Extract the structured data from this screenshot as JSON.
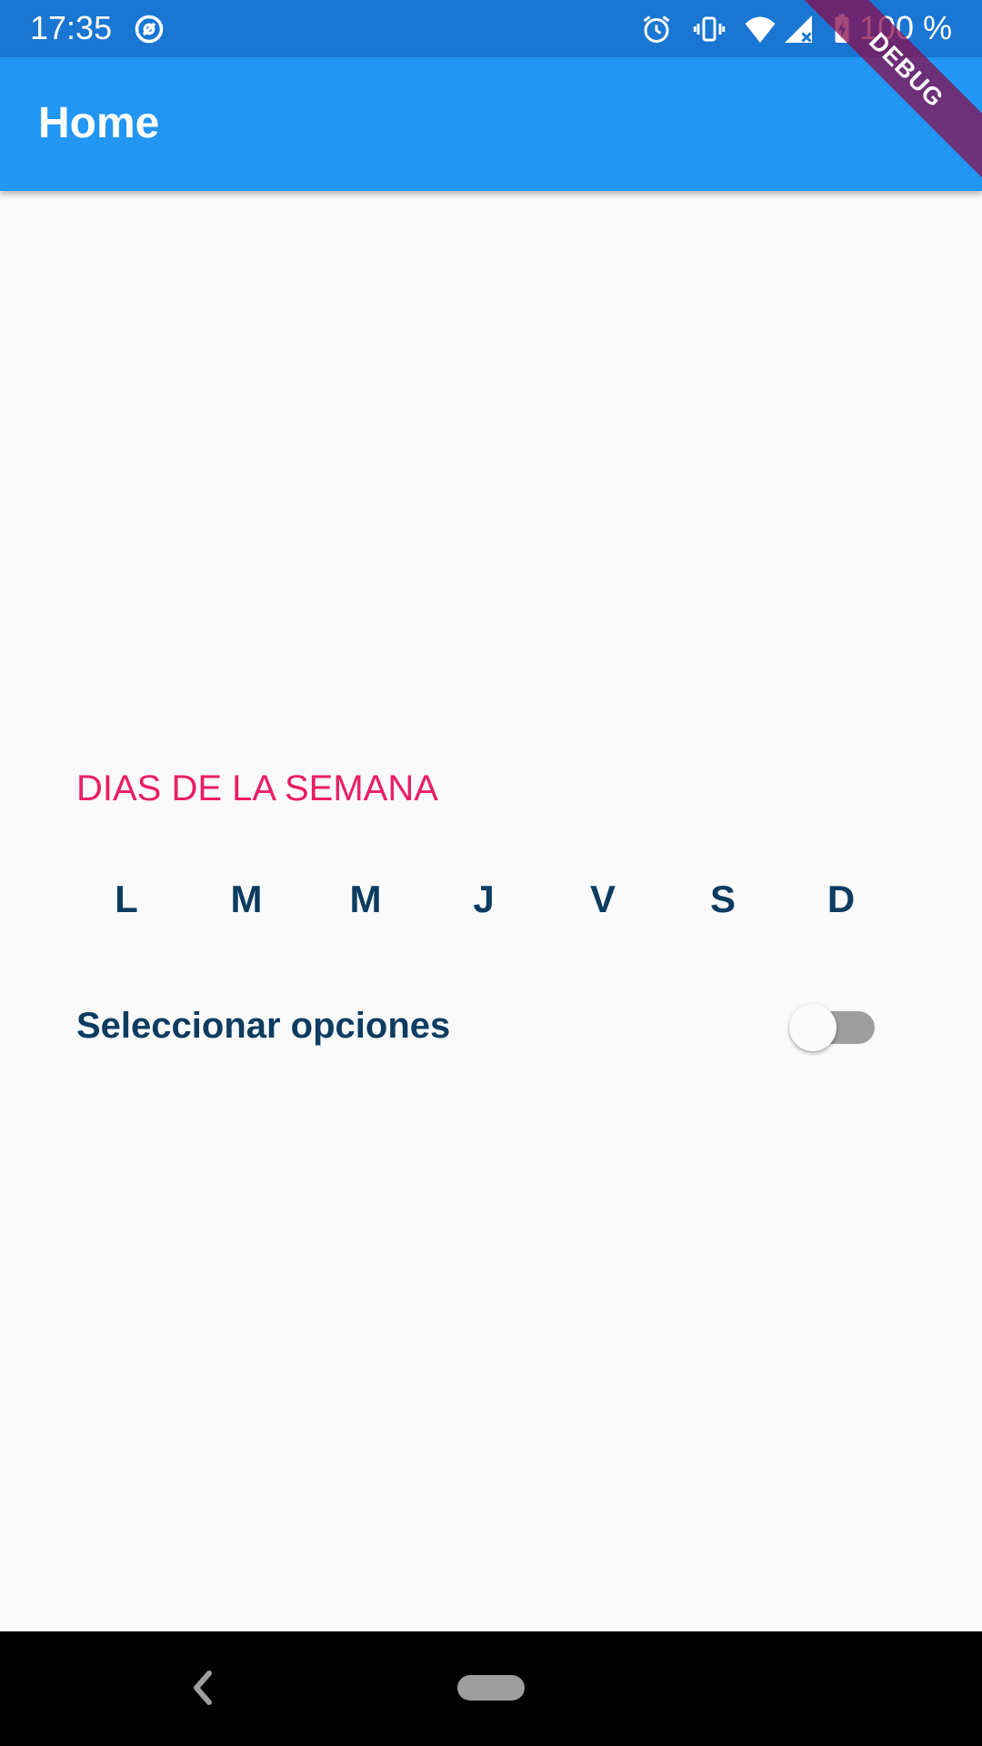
{
  "status_bar": {
    "time": "17:35",
    "battery": "100 %",
    "icons": [
      "at-sign-icon",
      "alarm-icon",
      "vibrate-icon",
      "wifi-icon",
      "signal-icon",
      "battery-charging-icon"
    ]
  },
  "app_bar": {
    "title": "Home",
    "color": "#2196f3"
  },
  "debug_banner": "DEBUG",
  "main": {
    "section_title": "DIAS DE LA SEMANA",
    "days": [
      "L",
      "M",
      "M",
      "J",
      "V",
      "S",
      "D"
    ],
    "options_label": "Seleccionar opciones",
    "options_switch_on": false
  },
  "colors": {
    "accent": "#e91e63",
    "text_primary": "#0d3c61",
    "status_bar": "#1976d2"
  },
  "nav_bar": {
    "icons": [
      "back-icon",
      "home-pill-icon"
    ]
  }
}
